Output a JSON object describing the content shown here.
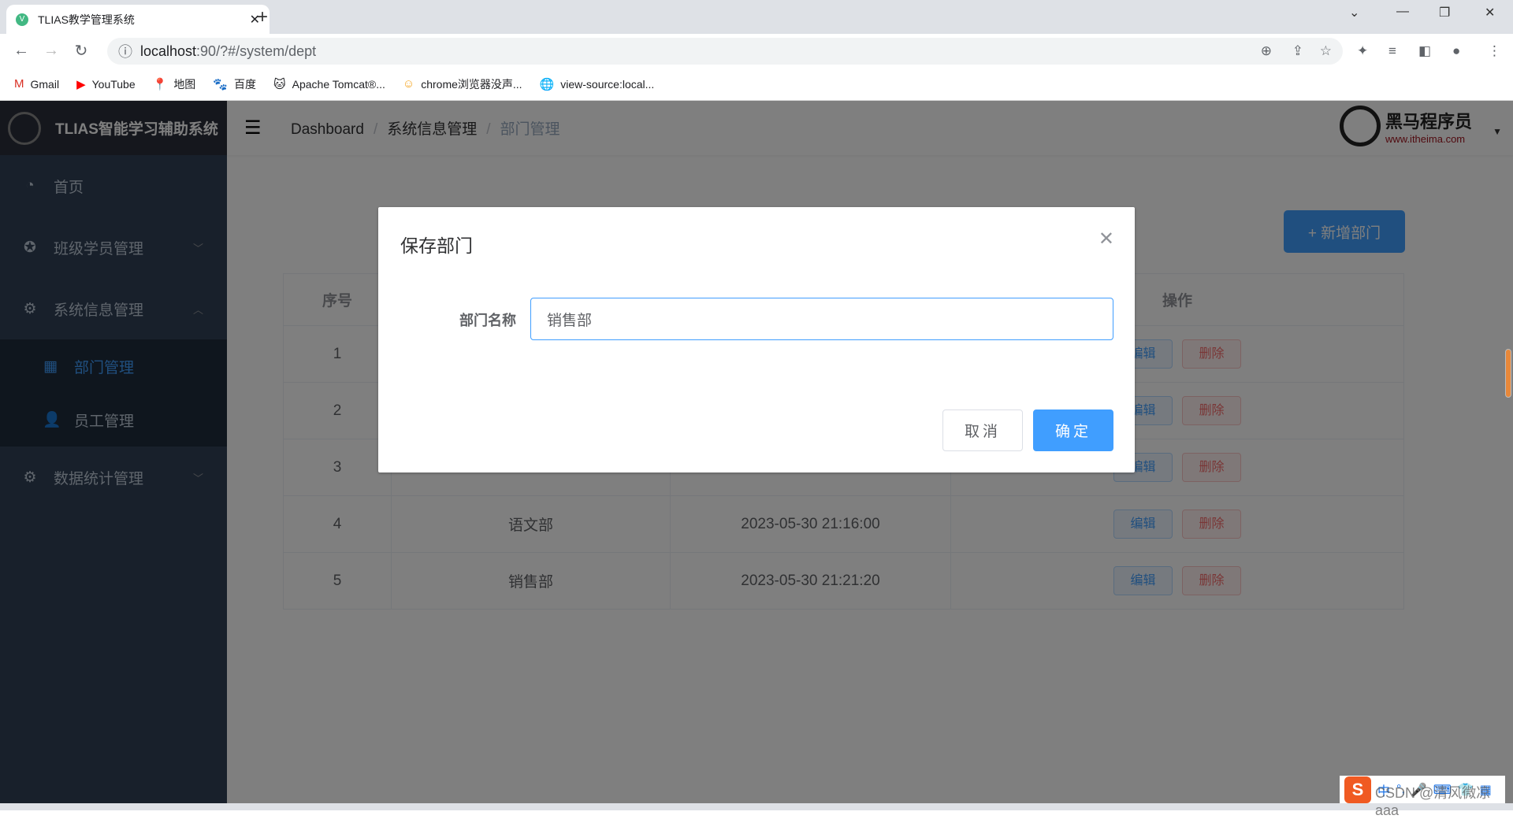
{
  "browser": {
    "tab_title": "TLIAS教学管理系统",
    "url_host": "localhost",
    "url_path": ":90/?#/system/dept",
    "bookmarks": [
      {
        "label": "Gmail",
        "icon": "M"
      },
      {
        "label": "YouTube",
        "icon": "▶"
      },
      {
        "label": "地图",
        "icon": "📍"
      },
      {
        "label": "百度",
        "icon": "🐾"
      },
      {
        "label": "Apache Tomcat®...",
        "icon": "🐱"
      },
      {
        "label": "chrome浏览器没声...",
        "icon": "☺"
      },
      {
        "label": "view-source:local...",
        "icon": "🌐"
      }
    ]
  },
  "sidebar": {
    "brand": "TLIAS智能学习辅助系统",
    "items": [
      {
        "label": "首页",
        "icon": "dashboard-icon"
      },
      {
        "label": "班级学员管理",
        "icon": "class-icon"
      },
      {
        "label": "系统信息管理",
        "icon": "gear-icon"
      },
      {
        "label": "数据统计管理",
        "icon": "gear-icon"
      }
    ],
    "sub_items": [
      {
        "label": "部门管理",
        "icon": "grid-icon",
        "active": true
      },
      {
        "label": "员工管理",
        "icon": "user-icon"
      }
    ]
  },
  "header": {
    "breadcrumb": [
      "Dashboard",
      "系统信息管理",
      "部门管理"
    ],
    "logo_name": "黑马程序员",
    "logo_url": "www.itheima.com"
  },
  "main": {
    "add_button": "+ 新增部门",
    "table": {
      "headers": [
        "序号",
        "",
        "",
        "操作"
      ],
      "rows": [
        {
          "no": "1",
          "name": "",
          "time": ""
        },
        {
          "no": "2",
          "name": "",
          "time": ""
        },
        {
          "no": "3",
          "name": "",
          "time": ""
        },
        {
          "no": "4",
          "name": "语文部",
          "time": "2023-05-30 21:16:00"
        },
        {
          "no": "5",
          "name": "销售部",
          "time": "2023-05-30 21:21:20"
        }
      ],
      "edit_label": "编辑",
      "delete_label": "删除"
    }
  },
  "dialog": {
    "title": "保存部门",
    "field_label": "部门名称",
    "field_value": "销售部",
    "cancel": "取消",
    "confirm": "确定"
  },
  "watermark": "CSDN @清风微凉 aaa",
  "ime": {
    "logo": "S",
    "mode": "中"
  },
  "colors": {
    "primary": "#409eff",
    "sidebar": "#304156",
    "danger": "#f56c6c"
  }
}
